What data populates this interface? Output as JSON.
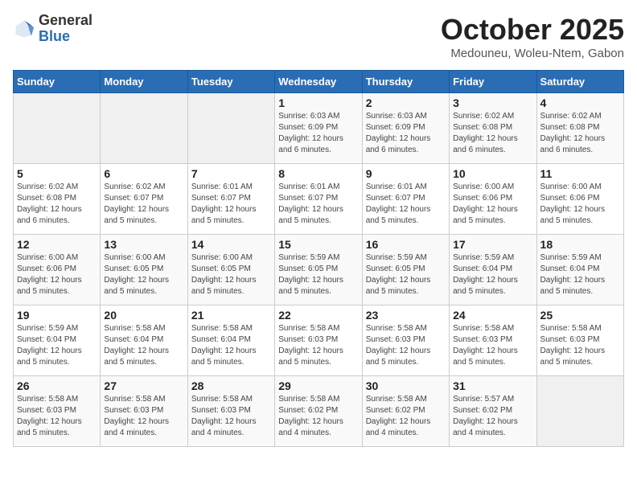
{
  "header": {
    "logo_general": "General",
    "logo_blue": "Blue",
    "month_title": "October 2025",
    "location": "Medouneu, Woleu-Ntem, Gabon"
  },
  "days_of_week": [
    "Sunday",
    "Monday",
    "Tuesday",
    "Wednesday",
    "Thursday",
    "Friday",
    "Saturday"
  ],
  "weeks": [
    [
      {
        "day": "",
        "info": ""
      },
      {
        "day": "",
        "info": ""
      },
      {
        "day": "",
        "info": ""
      },
      {
        "day": "1",
        "info": "Sunrise: 6:03 AM\nSunset: 6:09 PM\nDaylight: 12 hours and 6 minutes."
      },
      {
        "day": "2",
        "info": "Sunrise: 6:03 AM\nSunset: 6:09 PM\nDaylight: 12 hours and 6 minutes."
      },
      {
        "day": "3",
        "info": "Sunrise: 6:02 AM\nSunset: 6:08 PM\nDaylight: 12 hours and 6 minutes."
      },
      {
        "day": "4",
        "info": "Sunrise: 6:02 AM\nSunset: 6:08 PM\nDaylight: 12 hours and 6 minutes."
      }
    ],
    [
      {
        "day": "5",
        "info": "Sunrise: 6:02 AM\nSunset: 6:08 PM\nDaylight: 12 hours and 6 minutes."
      },
      {
        "day": "6",
        "info": "Sunrise: 6:02 AM\nSunset: 6:07 PM\nDaylight: 12 hours and 5 minutes."
      },
      {
        "day": "7",
        "info": "Sunrise: 6:01 AM\nSunset: 6:07 PM\nDaylight: 12 hours and 5 minutes."
      },
      {
        "day": "8",
        "info": "Sunrise: 6:01 AM\nSunset: 6:07 PM\nDaylight: 12 hours and 5 minutes."
      },
      {
        "day": "9",
        "info": "Sunrise: 6:01 AM\nSunset: 6:07 PM\nDaylight: 12 hours and 5 minutes."
      },
      {
        "day": "10",
        "info": "Sunrise: 6:00 AM\nSunset: 6:06 PM\nDaylight: 12 hours and 5 minutes."
      },
      {
        "day": "11",
        "info": "Sunrise: 6:00 AM\nSunset: 6:06 PM\nDaylight: 12 hours and 5 minutes."
      }
    ],
    [
      {
        "day": "12",
        "info": "Sunrise: 6:00 AM\nSunset: 6:06 PM\nDaylight: 12 hours and 5 minutes."
      },
      {
        "day": "13",
        "info": "Sunrise: 6:00 AM\nSunset: 6:05 PM\nDaylight: 12 hours and 5 minutes."
      },
      {
        "day": "14",
        "info": "Sunrise: 6:00 AM\nSunset: 6:05 PM\nDaylight: 12 hours and 5 minutes."
      },
      {
        "day": "15",
        "info": "Sunrise: 5:59 AM\nSunset: 6:05 PM\nDaylight: 12 hours and 5 minutes."
      },
      {
        "day": "16",
        "info": "Sunrise: 5:59 AM\nSunset: 6:05 PM\nDaylight: 12 hours and 5 minutes."
      },
      {
        "day": "17",
        "info": "Sunrise: 5:59 AM\nSunset: 6:04 PM\nDaylight: 12 hours and 5 minutes."
      },
      {
        "day": "18",
        "info": "Sunrise: 5:59 AM\nSunset: 6:04 PM\nDaylight: 12 hours and 5 minutes."
      }
    ],
    [
      {
        "day": "19",
        "info": "Sunrise: 5:59 AM\nSunset: 6:04 PM\nDaylight: 12 hours and 5 minutes."
      },
      {
        "day": "20",
        "info": "Sunrise: 5:58 AM\nSunset: 6:04 PM\nDaylight: 12 hours and 5 minutes."
      },
      {
        "day": "21",
        "info": "Sunrise: 5:58 AM\nSunset: 6:04 PM\nDaylight: 12 hours and 5 minutes."
      },
      {
        "day": "22",
        "info": "Sunrise: 5:58 AM\nSunset: 6:03 PM\nDaylight: 12 hours and 5 minutes."
      },
      {
        "day": "23",
        "info": "Sunrise: 5:58 AM\nSunset: 6:03 PM\nDaylight: 12 hours and 5 minutes."
      },
      {
        "day": "24",
        "info": "Sunrise: 5:58 AM\nSunset: 6:03 PM\nDaylight: 12 hours and 5 minutes."
      },
      {
        "day": "25",
        "info": "Sunrise: 5:58 AM\nSunset: 6:03 PM\nDaylight: 12 hours and 5 minutes."
      }
    ],
    [
      {
        "day": "26",
        "info": "Sunrise: 5:58 AM\nSunset: 6:03 PM\nDaylight: 12 hours and 5 minutes."
      },
      {
        "day": "27",
        "info": "Sunrise: 5:58 AM\nSunset: 6:03 PM\nDaylight: 12 hours and 4 minutes."
      },
      {
        "day": "28",
        "info": "Sunrise: 5:58 AM\nSunset: 6:03 PM\nDaylight: 12 hours and 4 minutes."
      },
      {
        "day": "29",
        "info": "Sunrise: 5:58 AM\nSunset: 6:02 PM\nDaylight: 12 hours and 4 minutes."
      },
      {
        "day": "30",
        "info": "Sunrise: 5:58 AM\nSunset: 6:02 PM\nDaylight: 12 hours and 4 minutes."
      },
      {
        "day": "31",
        "info": "Sunrise: 5:57 AM\nSunset: 6:02 PM\nDaylight: 12 hours and 4 minutes."
      },
      {
        "day": "",
        "info": ""
      }
    ]
  ]
}
